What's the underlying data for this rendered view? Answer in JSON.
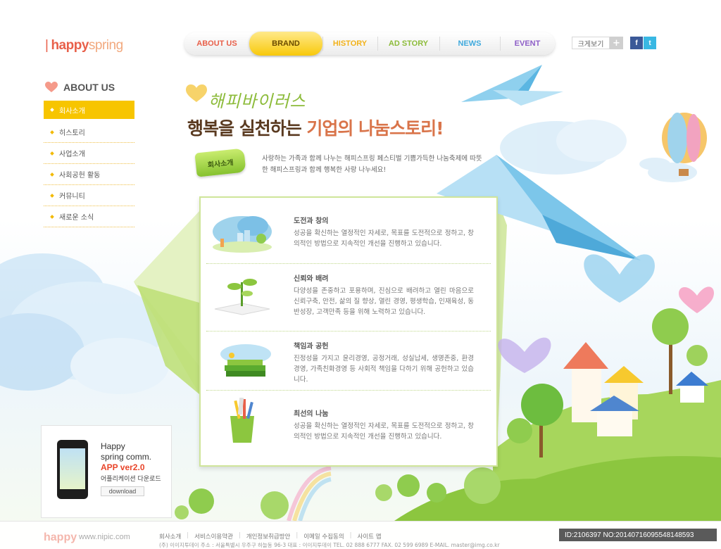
{
  "logo": {
    "bar": "|",
    "happy": "happy",
    "spring": "spring"
  },
  "nav": [
    {
      "label": "ABOUT US",
      "color": "#e8604a",
      "active": false
    },
    {
      "label": "BRAND",
      "color": "#6a4b00",
      "active": true
    },
    {
      "label": "HISTORY",
      "color": "#f2b21a",
      "active": false
    },
    {
      "label": "AD STORY",
      "color": "#8cbb3a",
      "active": false
    },
    {
      "label": "NEWS",
      "color": "#3fa9dc",
      "active": false
    },
    {
      "label": "EVENT",
      "color": "#8e5fc7",
      "active": false
    }
  ],
  "tools": {
    "size_label": "크게보기",
    "plus": "+",
    "facebook": "f",
    "twitter": "t"
  },
  "sidebar": {
    "heading": "ABOUT US",
    "items": [
      {
        "label": "회사소개",
        "active": true
      },
      {
        "label": "히스토리",
        "active": false
      },
      {
        "label": "사업소개",
        "active": false
      },
      {
        "label": "사회공헌 활동",
        "active": false
      },
      {
        "label": "커뮤니티",
        "active": false
      },
      {
        "label": "새로운 소식",
        "active": false
      }
    ]
  },
  "headline": {
    "script": "해피바이러스",
    "title_a": "행복을 실천하는 ",
    "title_b": "기업의 나눔스토리!",
    "tag": "회사소개",
    "intro": "사랑하는 가족과 함께 나누는 해피스프링 페스티벌 기쁨가득한 나눔축제에 따뜻한 해피스프링과 함께 행복한 사랑 나누세요!"
  },
  "sections": [
    {
      "heading": "도전과 창의",
      "body": "성공을 확신하는 열정적인 자세로, 목표를 도전적으로 정하고, 창의적인 방법으로 지속적인 개선을 진행하고 있습니다.",
      "icon": "city-landscape-icon"
    },
    {
      "heading": "신뢰와 배려",
      "body": "다양성을 존중하고 포용하며, 진심으로 배려하고 열린 마음으로 신뢰구축, 안전, 삶의 질 향상, 열린 경영, 평생학습, 인재육성, 동반성장, 고객만족 등을 위해 노력하고 있습니다.",
      "icon": "book-sprout-icon"
    },
    {
      "heading": "책임과 공헌",
      "body": "진정성을 가지고 윤리경영, 공정거래, 성실납세, 생명존중, 환경경영, 가족친화경영 등 사회적 책임을 다하기 위해 공헌하고 있습니다.",
      "icon": "stacked-books-icon"
    },
    {
      "heading": "최선의 나눔",
      "body": "성공을 확신하는 열정적인 자세로, 목표를 도전적으로 정하고, 창의적인 방법으로 지속적인 개선을 진행하고 있습니다.",
      "icon": "pencil-cup-icon"
    }
  ],
  "promo": {
    "line1": "Happy",
    "line2": "spring comm.",
    "line3": "APP ver2.0",
    "line4": "어플리케이션 다운로드",
    "download": "download"
  },
  "footer": {
    "logo": "happy",
    "watermark": "www.nipic.com",
    "links": [
      "회사소개",
      "서비스이용약관",
      "개인정보취급방안",
      "이메일 수집동의",
      "사이트 맵"
    ],
    "address": "(주) 이이지투데이  주소 : 서울특별시 우주구 하늘동 96-3  대표 : 이이지투데이  TEL. 02 888 6777  FAX. 02 599 6989  E-MAIL. master@img.co.kr",
    "id_text": "ID:2106397 NO:20140716095548148593"
  },
  "colors": {
    "accent_yellow": "#f7c500",
    "brand_orange": "#e8604a",
    "green": "#8cbb3a"
  }
}
